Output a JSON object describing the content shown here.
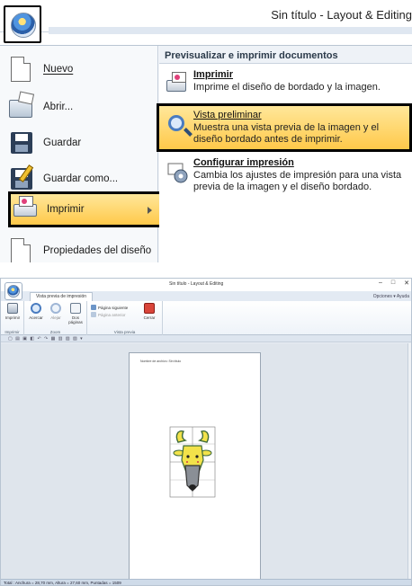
{
  "top": {
    "window_title": "Sin título - Layout & Editing",
    "left_menu": [
      {
        "label": "Nuevo",
        "icon": "new-document-icon"
      },
      {
        "label": "Abrir...",
        "icon": "open-folder-icon"
      },
      {
        "label": "Guardar",
        "icon": "save-disk-icon"
      },
      {
        "label": "Guardar como...",
        "icon": "save-as-icon"
      },
      {
        "label": "Imprimir",
        "icon": "printer-icon"
      },
      {
        "label": "Propiedades del diseño",
        "icon": "properties-icon"
      }
    ],
    "submenu": {
      "header": "Previsualizar e imprimir documentos",
      "items": [
        {
          "title": "Imprimir",
          "desc": "Imprime el diseño de bordado y la imagen."
        },
        {
          "title": "Vista preliminar",
          "desc": "Muestra una vista previa de la imagen y el diseño bordado antes de imprimir."
        },
        {
          "title": "Configurar impresión",
          "desc": "Cambia los ajustes de impresión para una vista previa de la imagen y el diseño bordado."
        }
      ]
    }
  },
  "bottom": {
    "window_title": "Sin título - Layout & Editing",
    "window_controls": [
      "–",
      "□",
      "✕"
    ],
    "active_tab": "Vista previa de impresión",
    "options": "Opciones",
    "help": "Ayuda",
    "ribbon": {
      "imprimir_group": "Imprimir",
      "zoom_group": "Zoom",
      "preview_group": "Vista previa",
      "btn_print": "Imprimir",
      "btn_zoom_in": "Acercar",
      "btn_zoom_out": "Alejar",
      "btn_two_pages": "Dos páginas",
      "next_page": "Página siguiente",
      "prev_page": "Página anterior",
      "btn_close": "Cerrar"
    },
    "page_caption": "Nombre de archivo: Sin título",
    "status": "Total : Anchura = 28,70 mm, Altura = 27,60 mm, Puntadas = 1509"
  },
  "colors": {
    "highlight_top": "#ffe79a",
    "highlight_bottom": "#ffc94a",
    "ribbon_bg": "#eef3f9",
    "workspace_bg": "#dfe5ec",
    "deer_yellow": "#f2e24a",
    "deer_green": "#3f6b3a",
    "deer_gray": "#8a8f96"
  }
}
